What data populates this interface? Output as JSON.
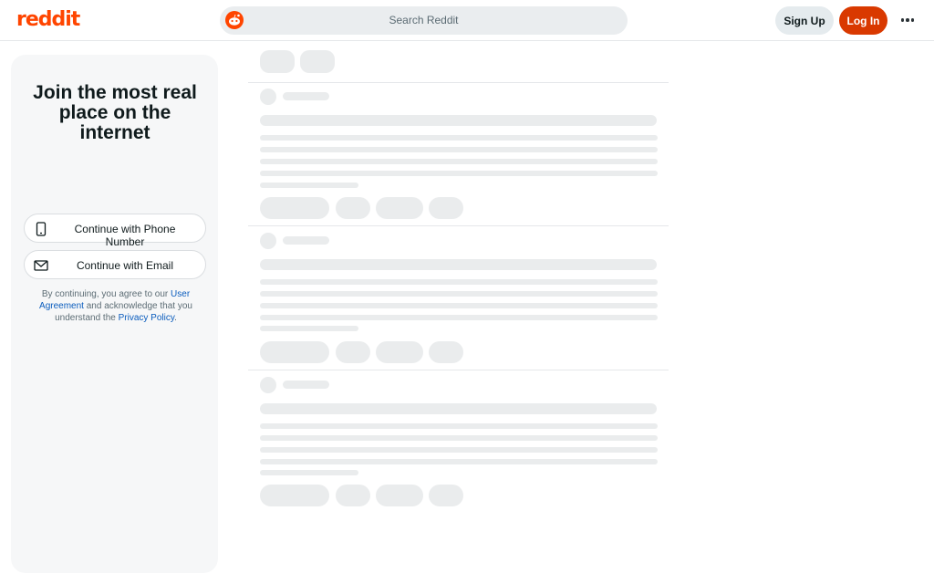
{
  "header": {
    "logo_text": "reddit",
    "search_placeholder": "Search Reddit",
    "signup_label": "Sign Up",
    "login_label": "Log In",
    "brand_color": "#ff4500",
    "login_color": "#d93900"
  },
  "sidebar": {
    "headline": "Join the most real place on the internet",
    "phone_button": "Continue with Phone Number",
    "email_button": "Continue with Email",
    "legal_prefix": "By continuing, you agree to our",
    "legal_link_agreement": "User Agreement",
    "legal_middle": "and acknowledge that you understand the",
    "legal_link_privacy": "Privacy Policy",
    "legal_suffix": "."
  },
  "icons": {
    "search": "reddit-snoo-icon",
    "phone": "phone-icon",
    "email": "email-icon",
    "more": "more-horizontal-icon"
  }
}
